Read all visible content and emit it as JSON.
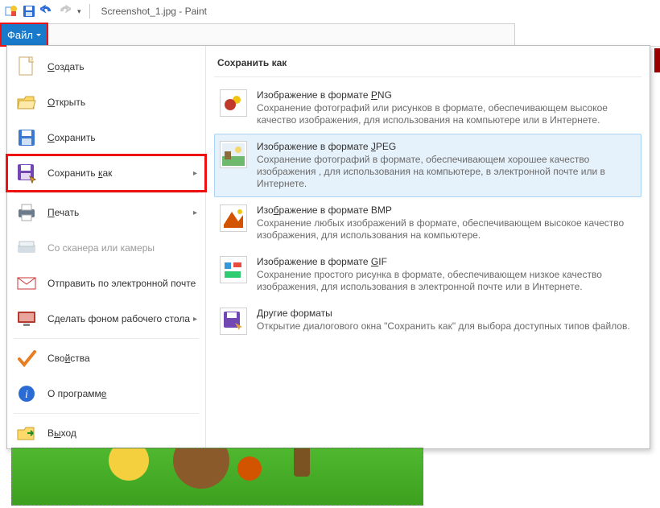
{
  "window": {
    "title": "Screenshot_1.jpg - Paint"
  },
  "file_tab": {
    "label": "Файл"
  },
  "left_menu": {
    "create": "Создать",
    "open": "Открыть",
    "save": "Сохранить",
    "save_as": "Сохранить как",
    "print": "Печать",
    "scanner": "Со сканера или камеры",
    "send_mail": "Отправить по электронной почте",
    "set_desktop": "Сделать фоном рабочего стола",
    "properties": "Свойства",
    "about": "О программе",
    "exit": "Выход"
  },
  "right_panel": {
    "heading": "Сохранить как",
    "formats": [
      {
        "title_pre": "Изображение в формате ",
        "title_ul": "P",
        "title_post": "NG",
        "desc": "Сохранение фотографий или рисунков в формате, обеспечивающем высокое качество изображения, для использования на компьютере или в Интернете."
      },
      {
        "title_pre": "Изображение в формате ",
        "title_ul": "J",
        "title_post": "PEG",
        "desc": "Сохранение фотографий в формате, обеспечивающем хорошее качество изображения , для использования на компьютере, в электронной почте или в Интернете."
      },
      {
        "title_pre": "Изо",
        "title_ul": "б",
        "title_post": "ражение в формате BMP",
        "desc": "Сохранение любых изображений в формате, обеспечивающем высокое качество изображения, для использования на компьютере."
      },
      {
        "title_pre": "Изображение в формате ",
        "title_ul": "G",
        "title_post": "IF",
        "desc": "Сохранение простого рисунка в формате, обеспечивающем низкое качество изображения, для использования в электронной почте или в Интернете."
      },
      {
        "title_pre": "",
        "title_ul": "Д",
        "title_post": "ругие форматы",
        "desc": "Открытие диалогового окна \"Сохранить как\" для выбора доступных типов файлов."
      }
    ]
  }
}
